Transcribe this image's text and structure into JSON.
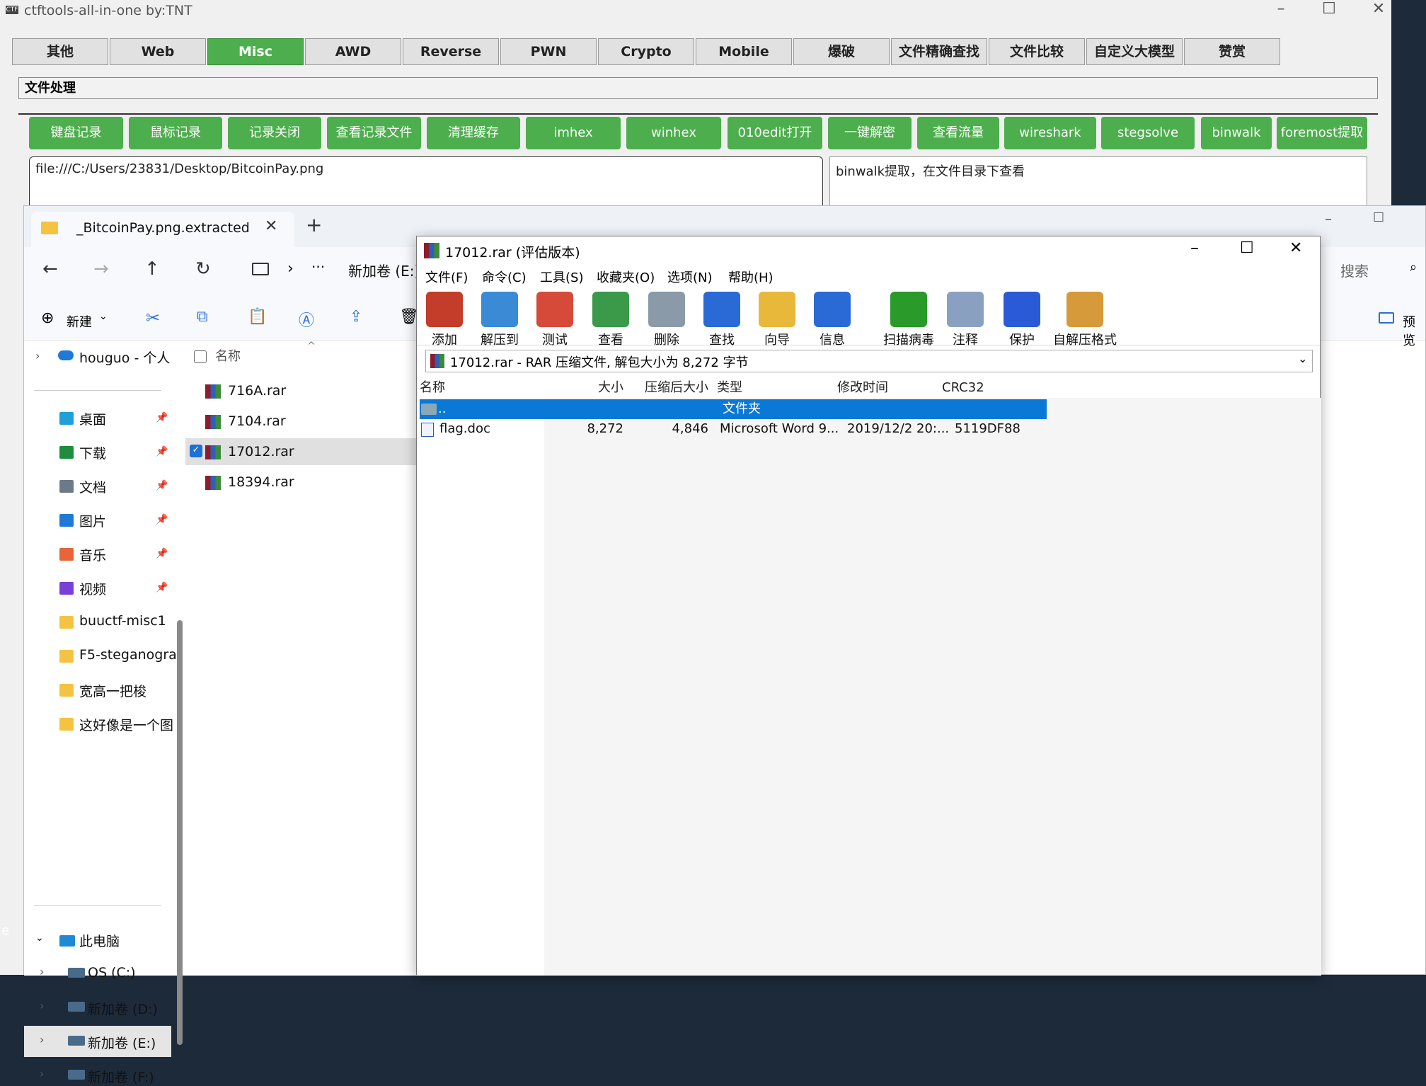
{
  "ctftools": {
    "title": "ctftools-all-in-one   by:TNT",
    "app_icon": "ctf-icon",
    "tabs": [
      "其他",
      "Web",
      "Misc",
      "AWD",
      "Reverse",
      "PWN",
      "Crypto",
      "Mobile",
      "爆破",
      "文件精确查找",
      "文件比较",
      "自定义大模型",
      "赞赏"
    ],
    "active_tab": "Misc",
    "section_title": "文件处理",
    "buttons": [
      "键盘记录",
      "鼠标记录",
      "记录关闭",
      "查看记录文件",
      "清理缓存",
      "imhex",
      "winhex",
      "010edit打开",
      "一键解密",
      "查看流量",
      "wireshark",
      "stegsolve",
      "binwalk",
      "foremost提取"
    ],
    "file_path": "file:///C:/Users/23831/Desktop/BitcoinPay.png",
    "output_text": "binwalk提取，在文件目录下查看",
    "accent": "#4cae4c"
  },
  "explorer": {
    "tab_title": "_BitcoinPay.png.extracted",
    "breadcrumb_more": "···",
    "breadcrumb_drive": "新加卷 (E:)",
    "search_placeholder": "搜索",
    "new_label": "新建",
    "preview_label": "预览",
    "column_name": "名称",
    "cloud_item": "houguo - 个人",
    "quick_access": [
      {
        "label": "桌面",
        "icon": "desktop-icon"
      },
      {
        "label": "下载",
        "icon": "download-icon"
      },
      {
        "label": "文档",
        "icon": "document-icon"
      },
      {
        "label": "图片",
        "icon": "picture-icon"
      },
      {
        "label": "音乐",
        "icon": "music-icon"
      },
      {
        "label": "视频",
        "icon": "video-icon"
      },
      {
        "label": "buuctf-misc1",
        "icon": "folder-icon"
      },
      {
        "label": "F5-steganogra",
        "icon": "folder-icon"
      },
      {
        "label": "宽高一把梭",
        "icon": "folder-icon"
      },
      {
        "label": "这好像是一个图",
        "icon": "folder-icon"
      }
    ],
    "this_pc": "此电脑",
    "drives": [
      "OS (C:)",
      "新加卷 (D:)",
      "新加卷 (E:)",
      "新加卷 (F:)"
    ],
    "files": [
      "716A.rar",
      "7104.rar",
      "17012.rar",
      "18394.rar"
    ],
    "selected_file": "17012.rar"
  },
  "winrar": {
    "title": "17012.rar (评估版本)",
    "menu": [
      "文件(F)",
      "命令(C)",
      "工具(S)",
      "收藏夹(O)",
      "选项(N)",
      "帮助(H)"
    ],
    "toolbar": [
      "添加",
      "解压到",
      "测试",
      "查看",
      "删除",
      "查找",
      "向导",
      "信息",
      "扫描病毒",
      "注释",
      "保护",
      "自解压格式"
    ],
    "path_bar": "17012.rar - RAR 压缩文件, 解包大小为 8,272 字节",
    "columns": [
      "名称",
      "大小",
      "压缩后大小",
      "类型",
      "修改时间",
      "CRC32"
    ],
    "parent_row": {
      "name": "..",
      "type": "文件夹"
    },
    "rows": [
      {
        "name": "flag.doc",
        "size": "8,272",
        "packed": "4,846",
        "type": "Microsoft Word 9...",
        "modified": "2019/12/2 20:...",
        "crc": "5119DF88"
      }
    ]
  },
  "desktop_edge_text": "e"
}
